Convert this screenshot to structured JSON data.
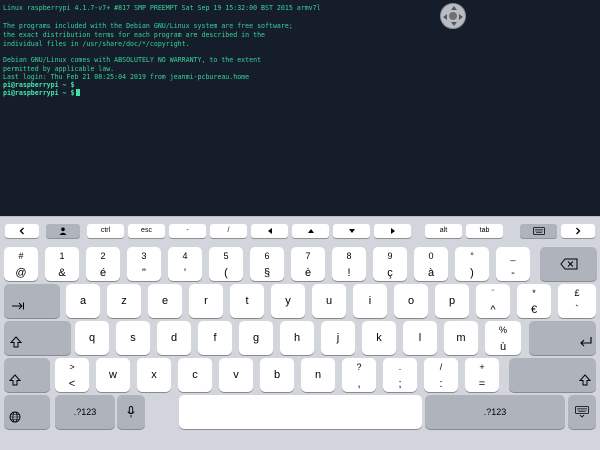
{
  "terminal": {
    "lines": [
      "Linux raspberrypi 4.1.7-v7+ #817 SMP PREEMPT Sat Sep 19 15:32:00 BST 2015 armv7l",
      "",
      "The programs included with the Debian GNU/Linux system are free software;",
      "the exact distribution terms for each program are described in the",
      "individual files in /usr/share/doc/*/copyright.",
      "",
      "Debian GNU/Linux comes with ABSOLUTELY NO WARRANTY, to the extent",
      "permitted by applicable law.",
      "Last login: Thu Feb 21 08:25:04 2019 from jeanmi-pcbureau.home"
    ],
    "prompt_lines": [
      "pi@raspberrypi ~ $",
      "pi@raspberrypi ~ $"
    ]
  },
  "toolbar": {
    "back_icon": "chevron-left-icon",
    "person_icon": "person-icon",
    "ctrl": "ctrl",
    "esc": "esc",
    "dash": "-",
    "slash": "/",
    "left_icon": "arrow-left-icon",
    "up_icon": "arrow-up-icon",
    "down_icon": "arrow-down-icon",
    "right_icon": "arrow-right-icon",
    "alt": "alt",
    "tab": "tab",
    "keyboard_icon": "keyboard-icon",
    "forward_icon": "chevron-right-icon"
  },
  "keyboard": {
    "row1": [
      {
        "top": "#",
        "bottom": "@"
      },
      {
        "top": "1",
        "bottom": "&"
      },
      {
        "top": "2",
        "bottom": "é"
      },
      {
        "top": "3",
        "bottom": "\""
      },
      {
        "top": "4",
        "bottom": "’"
      },
      {
        "top": "5",
        "bottom": "("
      },
      {
        "top": "6",
        "bottom": "§"
      },
      {
        "top": "7",
        "bottom": "è"
      },
      {
        "top": "8",
        "bottom": "!"
      },
      {
        "top": "9",
        "bottom": "ç"
      },
      {
        "top": "0",
        "bottom": "à"
      },
      {
        "top": "°",
        "bottom": ")"
      },
      {
        "top": "_",
        "bottom": "-"
      }
    ],
    "row2": [
      "a",
      "z",
      "e",
      "r",
      "t",
      "y",
      "u",
      "i",
      "o",
      "p"
    ],
    "row2_extra": [
      {
        "top": "¨",
        "bottom": "^"
      },
      {
        "top": "*",
        "bottom": "€"
      },
      {
        "top": "£",
        "bottom": "`"
      }
    ],
    "row3": [
      "q",
      "s",
      "d",
      "f",
      "g",
      "h",
      "j",
      "k",
      "l",
      "m"
    ],
    "row3_extra": {
      "top": "%",
      "bottom": "ù"
    },
    "row4_first": {
      "top": ">",
      "bottom": "<"
    },
    "row4": [
      "w",
      "x",
      "c",
      "v",
      "b",
      "n"
    ],
    "row4_extra": [
      {
        "top": "?",
        "bottom": ","
      },
      {
        "top": ".",
        "bottom": ";"
      },
      {
        "top": "/",
        "bottom": ":"
      },
      {
        "top": "+",
        "bottom": "="
      }
    ],
    "num_left": ".?123",
    "num_right": ".?123",
    "icons": {
      "delete": "backspace-icon",
      "tab": "tab-icon",
      "return": "return-icon",
      "shift": "shift-icon",
      "globe": "globe-icon",
      "mic": "microphone-icon",
      "hide": "keyboard-hide-icon"
    }
  }
}
